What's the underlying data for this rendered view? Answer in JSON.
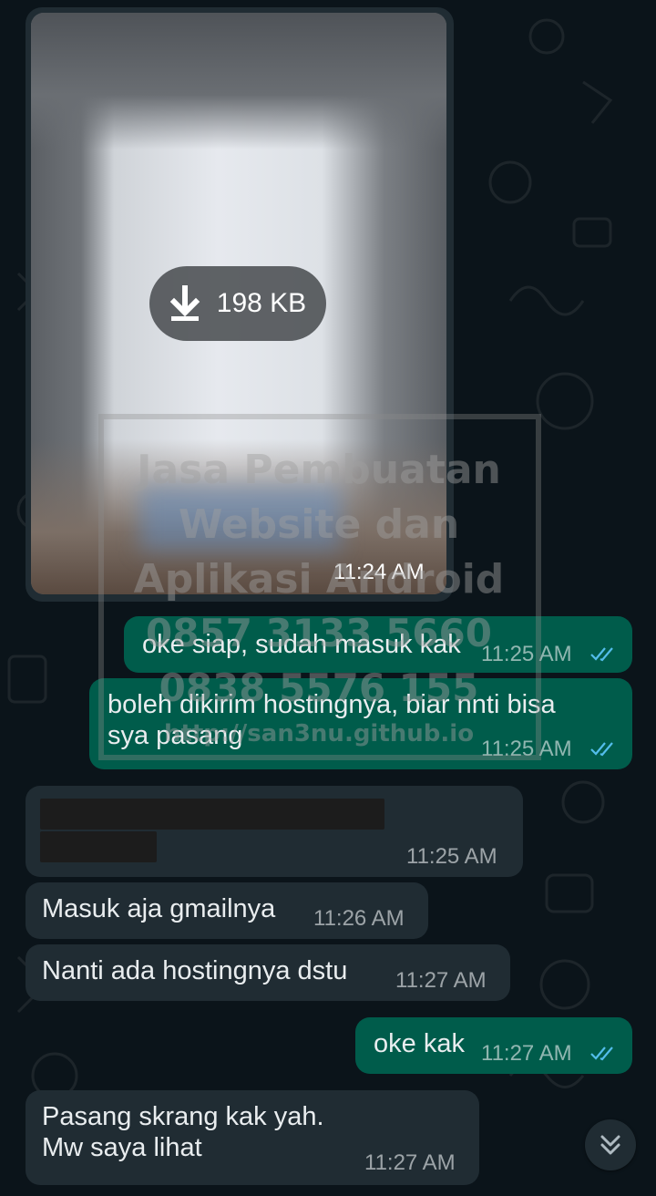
{
  "image_message": {
    "download_size": "198 KB",
    "time": "11:24 AM"
  },
  "watermark": {
    "lines": [
      "Jasa Pembuatan",
      "Website dan",
      "Aplikasi Android",
      "0857 3133 5660",
      "0838 5576 155",
      "http://san3nu.github.io"
    ]
  },
  "messages": [
    {
      "dir": "out",
      "text": "oke siap, sudah masuk kak",
      "time": "11:25 AM",
      "status": "read"
    },
    {
      "dir": "out",
      "text": "boleh dikirim hostingnya, biar nnti bisa\nsya pasang",
      "time": "11:25 AM",
      "status": "read"
    },
    {
      "dir": "in",
      "text": "",
      "time": "11:25 AM",
      "redacted": true
    },
    {
      "dir": "in",
      "text": "Masuk aja gmailnya",
      "time": "11:26 AM"
    },
    {
      "dir": "in",
      "text": "Nanti ada hostingnya dstu",
      "time": "11:27 AM"
    },
    {
      "dir": "out",
      "text": "oke kak",
      "time": "11:27 AM",
      "status": "read"
    },
    {
      "dir": "in",
      "text": "Pasang skrang kak yah.\nMw saya lihat",
      "time": "11:27 AM"
    }
  ],
  "icons": {
    "download": "download-arrow-icon",
    "read_receipt": "double-check-icon",
    "scroll_down": "double-chevron-down-icon"
  },
  "colors": {
    "background": "#0b141a",
    "incoming_bubble": "#202c33",
    "outgoing_bubble": "#005c4b",
    "read_tick": "#53bdeb"
  }
}
